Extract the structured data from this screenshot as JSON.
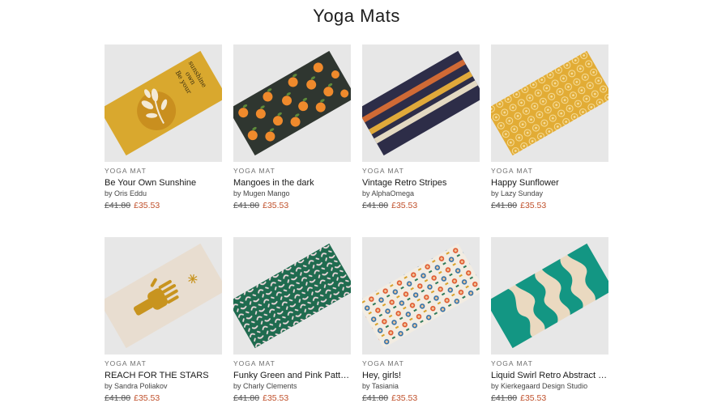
{
  "page": {
    "title": "Yoga Mats"
  },
  "products": [
    {
      "category": "YOGA MAT",
      "name": "Be Your Own Sunshine",
      "artist": "by Oris Eddu",
      "old_price": "£41.80",
      "price": "£35.53",
      "image": "mat-sunshine-mustard",
      "mat_text": "Be your own sunshine"
    },
    {
      "category": "YOGA MAT",
      "name": "Mangoes in the dark",
      "artist": "by Mugen Mango",
      "old_price": "£41.80",
      "price": "£35.53",
      "image": "mat-oranges-dark"
    },
    {
      "category": "YOGA MAT",
      "name": "Vintage Retro Stripes",
      "artist": "by AlphaOmega",
      "old_price": "£41.80",
      "price": "£35.53",
      "image": "mat-retro-stripes"
    },
    {
      "category": "YOGA MAT",
      "name": "Happy Sunflower",
      "artist": "by Lazy Sunday",
      "old_price": "£41.80",
      "price": "£35.53",
      "image": "mat-sunflower-pattern"
    },
    {
      "category": "YOGA MAT",
      "name": "REACH FOR THE STARS",
      "artist": "by Sandra Poliakov",
      "old_price": "£41.80",
      "price": "£35.53",
      "image": "mat-hand-star"
    },
    {
      "category": "YOGA MAT",
      "name": "Funky Green and Pink Pattern",
      "artist": "by Charly Clements",
      "old_price": "£41.80",
      "price": "£35.53",
      "image": "mat-green-squiggles"
    },
    {
      "category": "YOGA MAT",
      "name": "Hey, girls!",
      "artist": "by Tasiania",
      "old_price": "£41.80",
      "price": "£35.53",
      "image": "mat-girls-faces"
    },
    {
      "category": "YOGA MAT",
      "name": "Liquid Swirl Retro Abstract P...",
      "artist": "by Kierkegaard Design Studio",
      "old_price": "£41.80",
      "price": "£35.53",
      "image": "mat-liquid-swirl"
    }
  ],
  "colors": {
    "price": "#c0502b",
    "thumb_bg": "#e6e6e6"
  }
}
